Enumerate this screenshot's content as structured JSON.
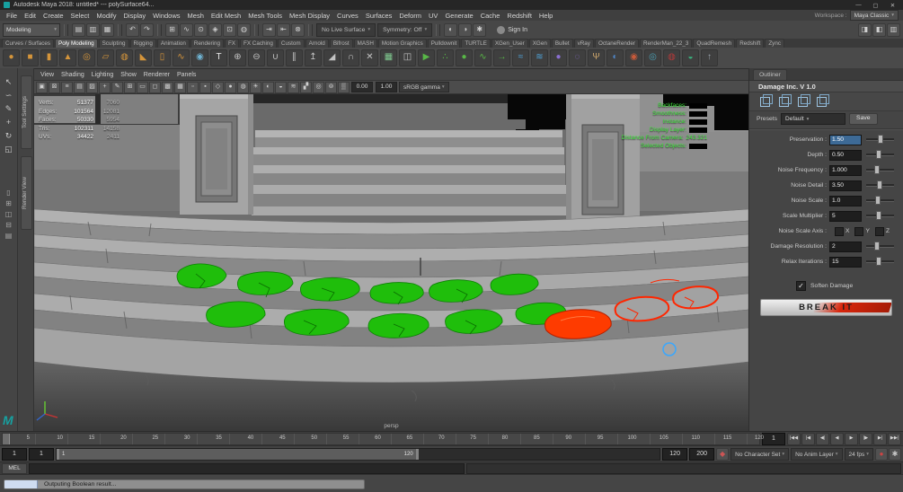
{
  "titlebar": {
    "title": "Autodesk Maya 2018: untitled* --- polySurface64...",
    "minimize": "—",
    "maximize": "▢",
    "close": "✕"
  },
  "maya_logo": "M",
  "menubar": {
    "menus": [
      "File",
      "Edit",
      "Create",
      "Select",
      "Modify",
      "Display",
      "Windows",
      "Mesh",
      "Edit Mesh",
      "Mesh Tools",
      "Mesh Display",
      "Curves",
      "Surfaces",
      "Deform",
      "UV",
      "Generate",
      "Cache",
      "Redshift",
      "Help"
    ],
    "workspace_label": "Workspace :",
    "workspace_value": "Maya Classic"
  },
  "statusline": {
    "mode": "Modeling",
    "file_icons": [
      {
        "n": "new-scene",
        "g": "▤"
      },
      {
        "n": "open-scene",
        "g": "▥"
      },
      {
        "n": "save-scene",
        "g": "▦"
      }
    ],
    "edit_icons": [
      {
        "n": "undo",
        "g": "↶"
      },
      {
        "n": "redo",
        "g": "↷"
      }
    ],
    "snap_icons": [
      {
        "n": "snap-to-grid",
        "g": "⊞"
      },
      {
        "n": "snap-to-curve",
        "g": "∿"
      },
      {
        "n": "snap-to-point",
        "g": "⊙"
      },
      {
        "n": "snap-to-projected-center",
        "g": "◈"
      },
      {
        "n": "snap-to-view-plane",
        "g": "⊡"
      },
      {
        "n": "make-live",
        "g": "◍"
      }
    ],
    "history_icons": [
      {
        "n": "input-connections",
        "g": "⇥"
      },
      {
        "n": "output-connections",
        "g": "⇤"
      },
      {
        "n": "construction-history",
        "g": "⊗"
      }
    ],
    "live_surface": "No Live Surface",
    "symmetry": "Symmetry: Off",
    "render_icons": [
      {
        "n": "render-current-frame",
        "g": "◐"
      },
      {
        "n": "ipr-render",
        "g": "◑"
      },
      {
        "n": "render-settings",
        "g": "✱"
      }
    ],
    "sign_in": "Sign In",
    "panel_toggles": [
      {
        "n": "attribute-editor-toggle",
        "g": "◨"
      },
      {
        "n": "tool-settings-toggle",
        "g": "◧"
      },
      {
        "n": "channel-box-toggle",
        "g": "▥"
      }
    ]
  },
  "shelf": {
    "active": "Poly Modeling",
    "tabs": [
      "Curves / Surfaces",
      "Poly Modeling",
      "Sculpting",
      "Rigging",
      "Animation",
      "Rendering",
      "FX",
      "FX Caching",
      "Custom",
      "Arnold",
      "Bifrost",
      "MASH",
      "Motion Graphics",
      "Pulldownit",
      "TURTLE",
      "XGen_User",
      "XGen",
      "Bullet",
      "vRay",
      "OctaneRender",
      "RenderMan_22_3",
      "QuadRemesh",
      "Redshift",
      "Zync"
    ],
    "icons": [
      {
        "n": "poly-sphere",
        "g": "●",
        "c": "#d5953b"
      },
      {
        "n": "poly-cube",
        "g": "■",
        "c": "#d5953b"
      },
      {
        "n": "poly-cylinder",
        "g": "▮",
        "c": "#d5953b"
      },
      {
        "n": "poly-cone",
        "g": "▲",
        "c": "#d5953b"
      },
      {
        "n": "poly-torus",
        "g": "◎",
        "c": "#d5953b"
      },
      {
        "n": "poly-plane",
        "g": "▱",
        "c": "#d5953b"
      },
      {
        "n": "poly-disc",
        "g": "◍",
        "c": "#d5953b"
      },
      {
        "n": "poly-pyramid",
        "g": "◣",
        "c": "#d5953b"
      },
      {
        "n": "poly-pipe",
        "g": "▯",
        "c": "#d5953b"
      },
      {
        "n": "poly-helix",
        "g": "∿",
        "c": "#d5953b"
      },
      {
        "n": "smooth-mesh",
        "g": "◉",
        "c": "#6fb3d2"
      },
      {
        "n": "type-tool",
        "g": "T",
        "c": "#e9e9e9"
      },
      {
        "n": "boolean-union",
        "g": "⊕",
        "c": "#c2c2c2"
      },
      {
        "n": "boolean-difference",
        "g": "⊖",
        "c": "#c2c2c2"
      },
      {
        "n": "combine",
        "g": "∪",
        "c": "#c2c2c2"
      },
      {
        "n": "separate",
        "g": "∥",
        "c": "#c2c2c2"
      },
      {
        "n": "extrude",
        "g": "↥",
        "c": "#c2c2c2"
      },
      {
        "n": "bevel",
        "g": "◢",
        "c": "#c2c2c2"
      },
      {
        "n": "bridge",
        "g": "∩",
        "c": "#c2c2c2"
      },
      {
        "n": "multi-cut",
        "g": "✕",
        "c": "#c2c2c2"
      },
      {
        "n": "quad-draw",
        "g": "▦",
        "c": "#7fc98f"
      },
      {
        "n": "mirror",
        "g": "◫",
        "c": "#c2c2c2"
      },
      {
        "n": "mash-network",
        "g": "▶",
        "c": "#58b747"
      },
      {
        "n": "mash-distribute",
        "g": "∴",
        "c": "#58b747"
      },
      {
        "n": "mash-dynamics",
        "g": "●",
        "c": "#58b747"
      },
      {
        "n": "mash-curve",
        "g": "∿",
        "c": "#58b747"
      },
      {
        "n": "motion-trail",
        "g": "→",
        "c": "#58b747"
      },
      {
        "n": "bifrost-liquid",
        "g": "≈",
        "c": "#4fa3d8"
      },
      {
        "n": "bifrost-aero",
        "g": "≋",
        "c": "#4fa3d8"
      },
      {
        "n": "bullet-rigid-body",
        "g": "●",
        "c": "#8a6fd1"
      },
      {
        "n": "bullet-soft-body",
        "g": "◌",
        "c": "#8a6fd1"
      },
      {
        "n": "xgen-hair",
        "g": "Ψ",
        "c": "#c9a36a"
      },
      {
        "n": "arnold-render",
        "g": "◐",
        "c": "#4f86c6"
      },
      {
        "n": "redshift-render",
        "g": "◉",
        "c": "#c85a3a"
      },
      {
        "n": "vray-render",
        "g": "◎",
        "c": "#4aa0b5"
      },
      {
        "n": "octane-render",
        "g": "◍",
        "c": "#b53a3a"
      },
      {
        "n": "renderman-render",
        "g": "◒",
        "c": "#3ab57f"
      },
      {
        "n": "zync-upload",
        "g": "↑",
        "c": "#9fa8b0"
      }
    ]
  },
  "toolbox": {
    "tools": [
      {
        "n": "select-tool",
        "g": "↖"
      },
      {
        "n": "lasso-tool",
        "g": "∽"
      },
      {
        "n": "paint-select-tool",
        "g": "✎"
      },
      {
        "n": "move-tool",
        "g": "+"
      },
      {
        "n": "rotate-tool",
        "g": "↻"
      },
      {
        "n": "scale-tool",
        "g": "◱"
      }
    ],
    "layouts": [
      {
        "n": "layout-single-pane",
        "g": "▯"
      },
      {
        "n": "layout-four-pane",
        "g": "⊞"
      },
      {
        "n": "layout-persp-outliner",
        "g": "◫"
      },
      {
        "n": "layout-top-persp",
        "g": "⊟"
      },
      {
        "n": "layout-hypershade",
        "g": "▤"
      }
    ]
  },
  "side_tabs": [
    "Tool Settings",
    "Render View"
  ],
  "viewport": {
    "menus": [
      "View",
      "Shading",
      "Lighting",
      "Show",
      "Renderer",
      "Panels"
    ],
    "icons": [
      {
        "n": "select-camera",
        "g": "▣"
      },
      {
        "n": "lock-camera",
        "g": "⊠"
      },
      {
        "n": "camera-attributes",
        "g": "≡"
      },
      {
        "n": "bookmarks",
        "g": "▤"
      },
      {
        "n": "image-plane",
        "g": "▨"
      },
      {
        "n": "pan-zoom-2d",
        "g": "+"
      },
      {
        "n": "grease-pencil",
        "g": "✎"
      },
      {
        "n": "grid-toggle",
        "g": "⊞"
      },
      {
        "n": "film-gate",
        "g": "▭"
      },
      {
        "n": "resolution-gate",
        "g": "◻"
      },
      {
        "n": "gate-mask",
        "g": "▩"
      },
      {
        "n": "field-chart",
        "g": "▦"
      },
      {
        "n": "safe-action",
        "g": "▫"
      },
      {
        "n": "safe-title",
        "g": "▪"
      },
      {
        "n": "wireframe-mode",
        "g": "◇"
      },
      {
        "n": "shaded-mode",
        "g": "●"
      },
      {
        "n": "textured-mode",
        "g": "◍"
      },
      {
        "n": "use-all-lights",
        "g": "☀"
      },
      {
        "n": "shadows-toggle",
        "g": "◐"
      },
      {
        "n": "ambient-occlusion",
        "g": "◒"
      },
      {
        "n": "motion-blur-toggle",
        "g": "≋"
      },
      {
        "n": "anti-aliasing",
        "g": "▞"
      },
      {
        "n": "depth-of-field",
        "g": "◎"
      },
      {
        "n": "isolate-select",
        "g": "⊚"
      },
      {
        "n": "x-ray-mode",
        "g": "▒"
      }
    ],
    "exposure": "0.00",
    "gamma": "1.00",
    "view_transform": "sRGB gamma",
    "camera_label": "persp",
    "hud_stats": [
      {
        "l": "Verts:",
        "a": "51377",
        "b": "7060"
      },
      {
        "l": "Edges:",
        "a": "101564",
        "b": "12081"
      },
      {
        "l": "Faces:",
        "a": "50330",
        "b": "5954"
      },
      {
        "l": "Tris:",
        "a": "102311",
        "b": "14158"
      },
      {
        "l": "UVs:",
        "a": "34422",
        "b": "2411"
      }
    ],
    "hud_right": [
      {
        "l": "Backfaces:",
        "v": "",
        "glitch": true
      },
      {
        "l": "Smoothness:",
        "v": "",
        "glitch": true
      },
      {
        "l": "Instance:",
        "v": "",
        "glitch": true
      },
      {
        "l": "Display Layer:",
        "v": "",
        "glitch": true
      },
      {
        "l": "Distance From Camera:",
        "v": "243.321",
        "glitch": false
      },
      {
        "l": "Selected Objects:",
        "v": "",
        "glitch": true
      }
    ]
  },
  "panel": {
    "dock_tab": "Outliner",
    "title": "Damage Inc. V 1.0",
    "presets_label": "Presets",
    "preset_value": "Default",
    "save_label": "Save",
    "check_glyph": "✓",
    "rows": [
      {
        "t": "s",
        "label": "Preservation :",
        "value": "1.50",
        "pct": 50,
        "sel": true
      },
      {
        "t": "s",
        "label": "Depth :",
        "value": "0.50",
        "pct": 45
      },
      {
        "t": "s",
        "label": "Noise Frequency :",
        "value": "1.000",
        "pct": 40
      },
      {
        "t": "s",
        "label": "Noise Detail :",
        "value": "3.50",
        "pct": 48
      },
      {
        "t": "s",
        "label": "Noise Scale :",
        "value": "1.0",
        "pct": 42
      },
      {
        "t": "s",
        "label": "Scale Multiplier :",
        "value": "5",
        "pct": 45
      },
      {
        "t": "a",
        "label": "Noise Scale Axis :",
        "axes": [
          {
            "l": "X",
            "c": false
          },
          {
            "l": "Y",
            "c": false
          },
          {
            "l": "Z",
            "c": false
          }
        ]
      },
      {
        "t": "s",
        "label": "Damage Resolution :",
        "value": "2",
        "pct": 40
      },
      {
        "t": "s",
        "label": "Relax Iterations :",
        "value": "15",
        "pct": 45
      }
    ],
    "soften_label": "Soften Damage",
    "soften_checked": true,
    "break_label": "BREAK IT"
  },
  "timeline": {
    "min": 1,
    "max": 120,
    "labels": [
      "5",
      "10",
      "15",
      "20",
      "25",
      "30",
      "35",
      "40",
      "45",
      "50",
      "55",
      "60",
      "65",
      "70",
      "75",
      "80",
      "85",
      "90",
      "95",
      "100",
      "105",
      "110",
      "115",
      "120"
    ],
    "current": "1",
    "transport": [
      {
        "n": "go-to-start",
        "g": "|◀◀"
      },
      {
        "n": "step-back-frame",
        "g": "|◀"
      },
      {
        "n": "step-back-key",
        "g": "◀|"
      },
      {
        "n": "play-backwards",
        "g": "◀"
      },
      {
        "n": "play-forwards",
        "g": "▶"
      },
      {
        "n": "step-forward-key",
        "g": "|▶"
      },
      {
        "n": "step-forward-frame",
        "g": "▶|"
      },
      {
        "n": "go-to-end",
        "g": "▶▶|"
      }
    ]
  },
  "range": {
    "anim_start": "1",
    "play_start": "1",
    "play_end": "120",
    "anim_end": "200",
    "bar_start_label": "1",
    "bar_end_label": "120",
    "bar_left_pct": 0,
    "bar_width_pct": 60,
    "key_icons": [
      {
        "n": "set-key",
        "g": "◆",
        "c": "#cc5555"
      }
    ],
    "character_set": "No Character Set",
    "anim_layer": "No Anim Layer",
    "fps": "24 fps",
    "right_icons": [
      {
        "n": "auto-keyframe",
        "g": "●",
        "c": "#cc4444"
      },
      {
        "n": "animation-preferences",
        "g": "✱",
        "c": "#c8c8c8"
      }
    ]
  },
  "command": {
    "label": "MEL"
  },
  "help": {
    "message": "Outputing Boolean result...",
    "progress_pct": 9
  }
}
